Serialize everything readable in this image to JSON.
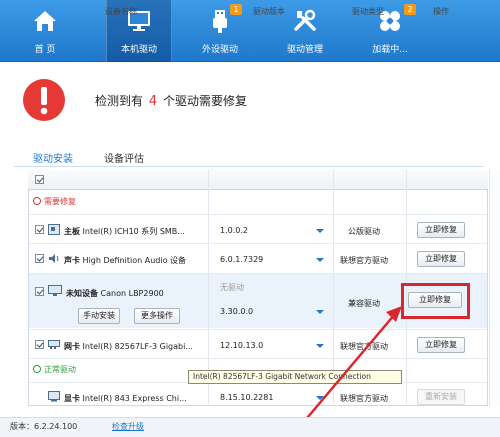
{
  "nav": {
    "items": [
      {
        "label": "首 页",
        "icon": "home-icon"
      },
      {
        "label": "本机驱动",
        "icon": "monitor-icon"
      },
      {
        "label": "外设驱动",
        "icon": "usb-icon",
        "badge": "1"
      },
      {
        "label": "驱动管理",
        "icon": "tools-icon"
      },
      {
        "label": "加载中...",
        "icon": "clover-icon",
        "badge": "2"
      }
    ],
    "active": "本机驱动"
  },
  "alert": {
    "prefix": "检测到有",
    "count": "4",
    "suffix": "个驱动需要修复"
  },
  "tabs": [
    "驱动安装",
    "设备评估"
  ],
  "table": {
    "headers": {
      "device": "设备名称",
      "version": "驱动版本",
      "type": "驱动类型",
      "action": "操作"
    },
    "sections": {
      "needs_repair": "需要修复",
      "normal": "正常驱动"
    },
    "rows": [
      {
        "category": "主板",
        "name": "Intel(R) ICH10 系列 SMB...",
        "version": "1.0.0.2",
        "type": "公版驱动",
        "action": "立即修复"
      },
      {
        "category": "声卡",
        "name": "High Definition Audio 设备",
        "version": "6.0.1.7329",
        "type": "联想官方驱动",
        "action": "立即修复"
      },
      {
        "category": "未知设备",
        "name": "Canon LBP2900",
        "version_status": "无驱动",
        "version": "3.30.0.0",
        "type": "兼容驱动",
        "action": "立即修复",
        "sub_buttons": [
          "手动安装",
          "更多操作"
        ]
      },
      {
        "category": "网卡",
        "name": "Intel(R) 82567LF-3 Gigabi...",
        "version": "12.10.13.0",
        "type": "联想官方驱动",
        "action": "立即修复"
      },
      {
        "category": "显卡",
        "name": "Intel(R) 843 Express Chi...",
        "version": "8.15.10.2281",
        "type": "联想官方驱动",
        "action": "重新安装"
      }
    ]
  },
  "tooltip": "Intel(R) 82567LF-3 Gigabit Network Connection",
  "status": {
    "version": "版本：6.2.24.100",
    "check_update": "检查升级"
  },
  "colors": {
    "brand": "#1f78cc",
    "alert": "#e03030",
    "highlight": "#d8272d"
  }
}
